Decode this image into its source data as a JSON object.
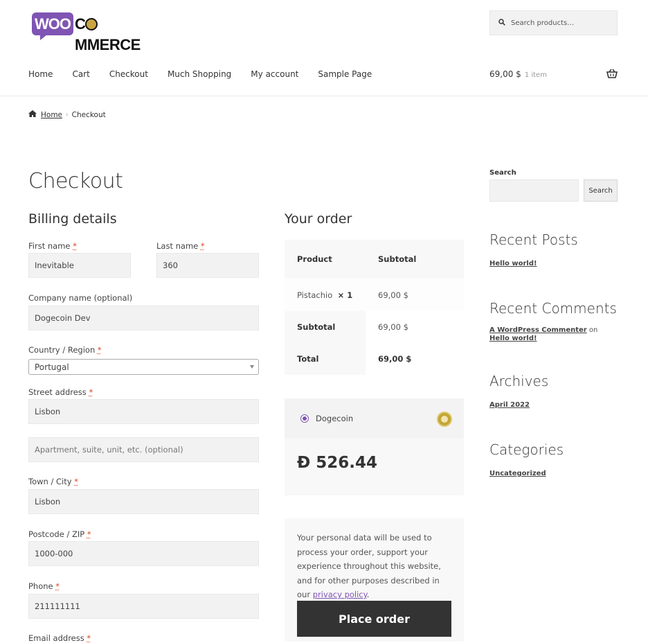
{
  "header": {
    "logo": {
      "woo": "WOO",
      "commerce_prefix": "C",
      "commerce_suffix": "MMERCE"
    },
    "search_placeholder": "Search products…",
    "nav": [
      "Home",
      "Cart",
      "Checkout",
      "Much Shopping",
      "My account",
      "Sample Page"
    ],
    "cart": {
      "total": "69,00 $",
      "count": "1 item"
    }
  },
  "breadcrumb": {
    "home": "Home",
    "current": "Checkout"
  },
  "page_title": "Checkout",
  "billing": {
    "title": "Billing details",
    "required_mark": "*",
    "fields": {
      "first_name": {
        "label": "First name",
        "value": "Inevitable"
      },
      "last_name": {
        "label": "Last name",
        "value": "360"
      },
      "company": {
        "label": "Company name (optional)",
        "value": "Dogecoin Dev"
      },
      "country": {
        "label": "Country / Region",
        "value": "Portugal"
      },
      "street": {
        "label": "Street address",
        "value": "Lisbon",
        "placeholder2": "Apartment, suite, unit, etc. (optional)"
      },
      "city": {
        "label": "Town / City",
        "value": "Lisbon"
      },
      "postcode": {
        "label": "Postcode / ZIP",
        "value": "1000-000"
      },
      "phone": {
        "label": "Phone",
        "value": "211111111"
      },
      "email": {
        "label": "Email address"
      }
    }
  },
  "order": {
    "title": "Your order",
    "headers": {
      "product": "Product",
      "subtotal": "Subtotal"
    },
    "items": [
      {
        "name": "Pistachio",
        "qty": "× 1",
        "subtotal": "69,00 $"
      }
    ],
    "subtotal_label": "Subtotal",
    "subtotal_value": "69,00 $",
    "total_label": "Total",
    "total_value": "69,00 $"
  },
  "payment": {
    "method": "Dogecoin",
    "amount": "Đ 526.44",
    "accent": "#7f54b3"
  },
  "terms": {
    "text": "Your personal data will be used to process your order, support your experience throughout this website, and for other purposes described in our ",
    "link": "privacy policy",
    "end": ".",
    "place_order": "Place order"
  },
  "sidebar": {
    "search_label": "Search",
    "search_button": "Search",
    "recent_posts": {
      "title": "Recent Posts",
      "items": [
        "Hello world!"
      ]
    },
    "recent_comments": {
      "title": "Recent Comments",
      "author": "A WordPress Commenter",
      "on": "on",
      "post": "Hello world!"
    },
    "archives": {
      "title": "Archives",
      "items": [
        "April 2022"
      ]
    },
    "categories": {
      "title": "Categories",
      "items": [
        "Uncategorized"
      ]
    }
  }
}
